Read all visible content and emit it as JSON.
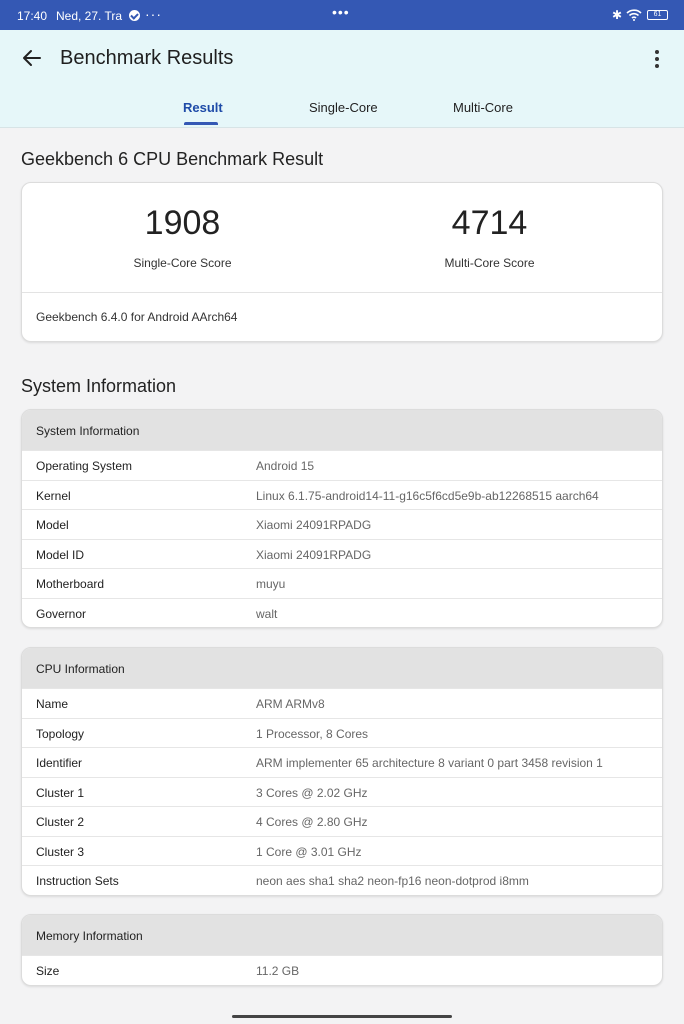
{
  "status_bar": {
    "time": "17:40",
    "date": "Ned, 27. Tra",
    "overflow": "···",
    "center": "•••",
    "bluetooth": "✱",
    "battery": "61"
  },
  "app_bar": {
    "title": "Benchmark Results",
    "tabs": [
      "Result",
      "Single-Core",
      "Multi-Core"
    ],
    "active_tab": "Result"
  },
  "result": {
    "heading": "Geekbench 6 CPU Benchmark Result",
    "single_core_score": "1908",
    "single_core_label": "Single-Core Score",
    "multi_core_score": "4714",
    "multi_core_label": "Multi-Core Score",
    "version": "Geekbench 6.4.0 for Android AArch64"
  },
  "system_heading": "System Information",
  "system_info": {
    "title": "System Information",
    "rows": [
      {
        "key": "Operating System",
        "value": "Android 15"
      },
      {
        "key": "Kernel",
        "value": "Linux 6.1.75-android14-11-g16c5f6cd5e9b-ab12268515 aarch64"
      },
      {
        "key": "Model",
        "value": "Xiaomi 24091RPADG"
      },
      {
        "key": "Model ID",
        "value": "Xiaomi 24091RPADG"
      },
      {
        "key": "Motherboard",
        "value": "muyu"
      },
      {
        "key": "Governor",
        "value": "walt"
      }
    ]
  },
  "cpu_info": {
    "title": "CPU Information",
    "rows": [
      {
        "key": "Name",
        "value": "ARM ARMv8"
      },
      {
        "key": "Topology",
        "value": "1 Processor, 8 Cores"
      },
      {
        "key": "Identifier",
        "value": "ARM implementer 65 architecture 8 variant 0 part 3458 revision 1"
      },
      {
        "key": "Cluster 1",
        "value": "3 Cores @ 2.02 GHz"
      },
      {
        "key": "Cluster 2",
        "value": "4 Cores @ 2.80 GHz"
      },
      {
        "key": "Cluster 3",
        "value": "1 Core @ 3.01 GHz"
      },
      {
        "key": "Instruction Sets",
        "value": "neon aes sha1 sha2 neon-fp16 neon-dotprod i8mm"
      }
    ]
  },
  "memory_info": {
    "title": "Memory Information",
    "rows": [
      {
        "key": "Size",
        "value": "11.2 GB"
      }
    ]
  },
  "colors": {
    "status_bar": "#3458b4",
    "app_bar": "#e6f7f9",
    "accent": "#1e4ba8",
    "background": "#f3f3f4",
    "section_header": "#e2e2e2"
  },
  "icons": {
    "back": "arrow-left-icon",
    "menu": "more-vertical-icon",
    "wifi": "wifi-icon",
    "bluetooth": "bluetooth-icon",
    "battery": "battery-icon",
    "verified": "check-circle-icon"
  }
}
